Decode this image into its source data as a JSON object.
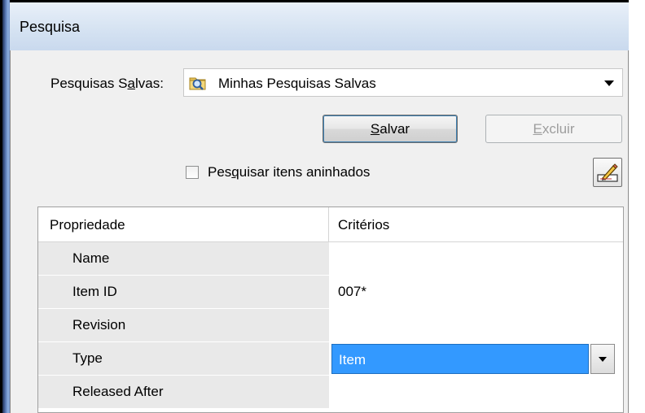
{
  "window": {
    "title": "Pesquisa"
  },
  "saved_searches": {
    "label_pre": "Pesquisas S",
    "label_u": "a",
    "label_post": "lvas:",
    "selected": "Minhas Pesquisas Salvas"
  },
  "buttons": {
    "save_u": "S",
    "save_rest": "alvar",
    "delete_u": "E",
    "delete_rest": "xcluir"
  },
  "nested": {
    "label_pre": "Pes",
    "label_u": "q",
    "label_post": "uisar itens aninhados",
    "checked": false
  },
  "table": {
    "headers": {
      "property": "Propriedade",
      "criteria": "Critérios"
    },
    "rows": [
      {
        "property": "Name",
        "value": ""
      },
      {
        "property": "Item ID",
        "value": "007*"
      },
      {
        "property": "Revision",
        "value": ""
      },
      {
        "property": "Type",
        "value": "Item"
      },
      {
        "property": "Released After",
        "value": ""
      }
    ]
  },
  "colors": {
    "selection": "#3399ff",
    "panel": "#f0f0f0",
    "title_bar": "#d6e3f2"
  }
}
